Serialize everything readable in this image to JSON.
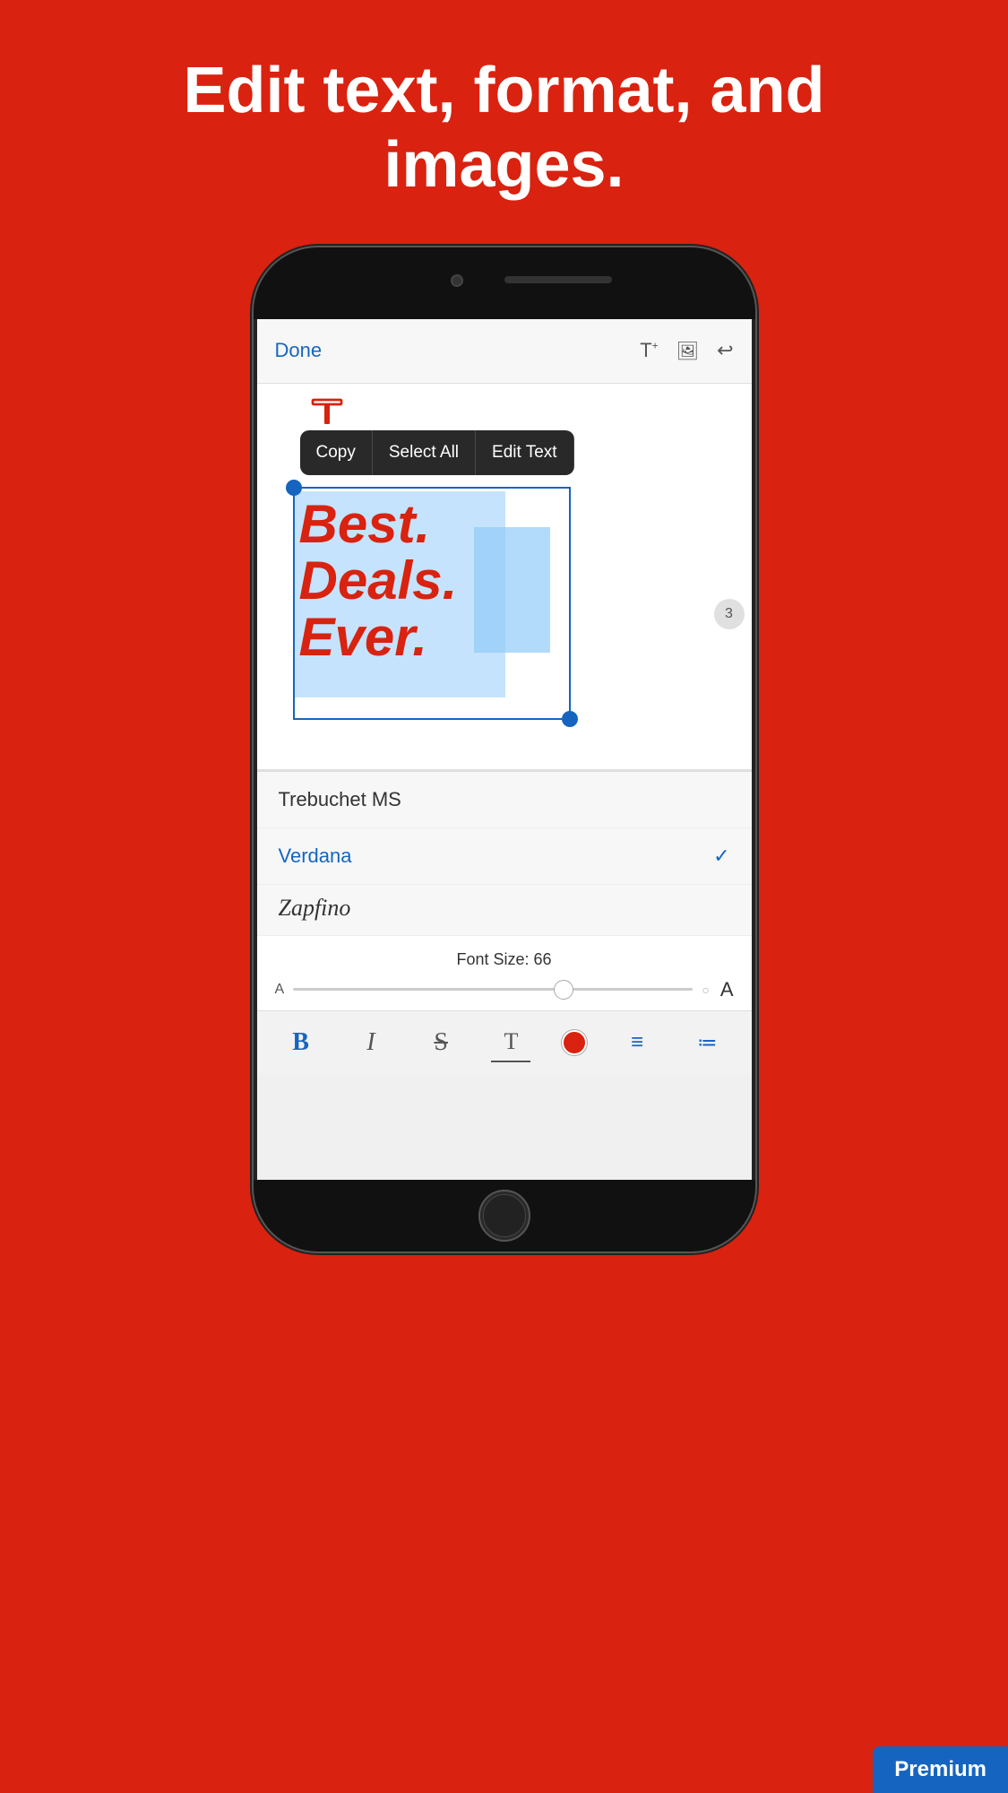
{
  "header": {
    "title": "Edit text, format, and images."
  },
  "app_bar": {
    "done_label": "Done",
    "icons": [
      "T+",
      "🖼+",
      "↩"
    ]
  },
  "context_menu": {
    "items": [
      "Copy",
      "Select All",
      "Edit Text"
    ]
  },
  "deals_text": {
    "line1": "Best.",
    "line2": "Deals.",
    "line3": "Ever."
  },
  "page_indicator": "3",
  "font_panel": {
    "fonts": [
      {
        "name": "Trebuchet MS",
        "selected": false
      },
      {
        "name": "Verdana",
        "selected": true
      },
      {
        "name": "Zapfino",
        "style": "script",
        "selected": false
      }
    ]
  },
  "font_size": {
    "label": "Font Size: 66",
    "value": 66,
    "min_label": "A",
    "max_label": "A"
  },
  "toolbar": {
    "buttons": [
      "B",
      "I",
      "S",
      "T",
      "●",
      "≡",
      "≔"
    ]
  },
  "premium": {
    "label": "Premium"
  }
}
